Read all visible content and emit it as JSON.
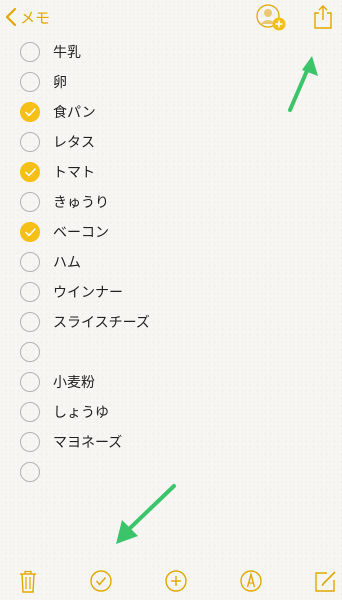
{
  "nav": {
    "back_label": "メモ",
    "accent": "#e0a800"
  },
  "checklist": [
    {
      "text": "牛乳",
      "checked": false
    },
    {
      "text": "卵",
      "checked": false
    },
    {
      "text": "食パン",
      "checked": true
    },
    {
      "text": "レタス",
      "checked": false
    },
    {
      "text": "トマト",
      "checked": true
    },
    {
      "text": "きゅうり",
      "checked": false
    },
    {
      "text": "ベーコン",
      "checked": true
    },
    {
      "text": "ハム",
      "checked": false
    },
    {
      "text": "ウインナー",
      "checked": false
    },
    {
      "text": "スライスチーズ",
      "checked": false
    },
    {
      "text": "",
      "checked": false
    },
    {
      "text": "小麦粉",
      "checked": false
    },
    {
      "text": "しょうゆ",
      "checked": false
    },
    {
      "text": "マヨネーズ",
      "checked": false
    },
    {
      "text": "",
      "checked": false
    }
  ],
  "colors": {
    "check_fill": "#f6bf16",
    "annotation_arrow": "#3cc46a"
  },
  "toolbar": {
    "icons": [
      "trash-icon",
      "checklist-icon",
      "add-icon",
      "sketch-icon",
      "compose-icon"
    ]
  }
}
